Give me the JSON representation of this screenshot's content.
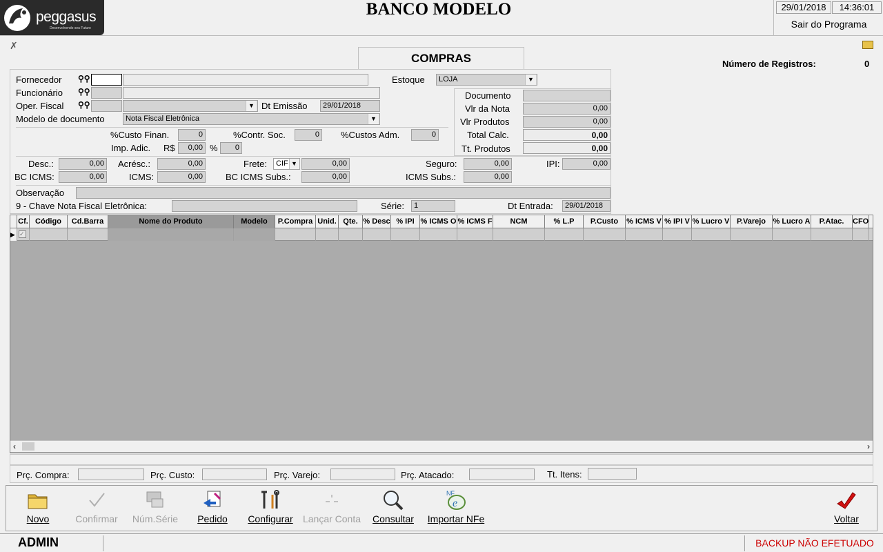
{
  "header": {
    "logo_text": "peggasus",
    "logo_tagline": "Desenvolvendo seu Futuro",
    "title": "BANCO MODELO",
    "date": "29/01/2018",
    "time": "14:36:01",
    "exit_label": "Sair do Programa"
  },
  "form": {
    "title": "COMPRAS",
    "num_registros_label": "Número de Registros:",
    "num_registros_value": "0",
    "fornecedor_label": "Fornecedor",
    "funcionario_label": "Funcionário",
    "oper_fiscal_label": "Oper. Fiscal",
    "modelo_doc_label": "Modelo de documento",
    "modelo_doc_value": "Nota Fiscal Eletrônica",
    "dt_emissao_label": "Dt Emissão",
    "dt_emissao_value": "29/01/2018",
    "estoque_label": "Estoque",
    "estoque_value": "LOJA",
    "documento_label": "Documento",
    "vlr_nota_label": "Vlr da Nota",
    "vlr_nota_value": "0,00",
    "vlr_produtos_label": "Vlr Produtos",
    "vlr_produtos_value": "0,00",
    "total_calc_label": "Total Calc.",
    "total_calc_value": "0,00",
    "tt_produtos_label": "Tt. Produtos",
    "tt_produtos_value": "0,00",
    "custo_finan_label": "%Custo Finan.",
    "custo_finan_value": "0",
    "contr_soc_label": "%Contr. Soc.",
    "contr_soc_value": "0",
    "custos_adm_label": "%Custos Adm.",
    "custos_adm_value": "0",
    "imp_adic_label": "Imp. Adic.",
    "rs_label": "R$",
    "imp_adic_rs_value": "0,00",
    "pct_label": "%",
    "imp_adic_pct_value": "0",
    "desc_label": "Desc.:",
    "desc_value": "0,00",
    "acresc_label": "Acrésc.:",
    "acresc_value": "0,00",
    "frete_label": "Frete:",
    "frete_type": "CIF",
    "frete_value": "0,00",
    "seguro_label": "Seguro:",
    "seguro_value": "0,00",
    "ipi_label": "IPI:",
    "ipi_value": "0,00",
    "bc_icms_label": "BC ICMS:",
    "bc_icms_value": "0,00",
    "icms_label": "ICMS:",
    "icms_value": "0,00",
    "bc_icms_subs_label": "BC ICMS Subs.:",
    "bc_icms_subs_value": "0,00",
    "icms_subs_label": "ICMS Subs.:",
    "icms_subs_value": "0,00",
    "observacao_label": "Observação",
    "chave_label": "9 - Chave Nota Fiscal Eletrônica:",
    "serie_label": "Série:",
    "serie_value": "1",
    "dt_entrada_label": "Dt Entrada:",
    "dt_entrada_value": "29/01/2018"
  },
  "grid": {
    "columns": [
      "Cf.",
      "Código",
      "Cd.Barra",
      "Nome do Produto",
      "Modelo",
      "P.Compra",
      "Unid.",
      "Qte.",
      "% Desc",
      "% IPI",
      "% ICMS O",
      "% ICMS F",
      "NCM",
      "% L.P",
      "P.Custo",
      "% ICMS V",
      "% IPI V",
      "% Lucro V",
      "P.Varejo",
      "% Lucro A",
      "P.Atac.",
      "CFO"
    ]
  },
  "footer_fields": {
    "prc_compra_label": "Prç. Compra:",
    "prc_custo_label": "Prç. Custo:",
    "prc_varejo_label": "Prç. Varejo:",
    "prc_atacado_label": "Prç. Atacado:",
    "tt_itens_label": "Tt. Itens:"
  },
  "toolbar": {
    "novo": "Novo",
    "confirmar": "Confirmar",
    "num_serie": "Núm.Série",
    "pedido": "Pedido",
    "configurar": "Configurar",
    "lancar_conta": "Lançar Conta",
    "consultar": "Consultar",
    "importar_nfe": "Importar NFe",
    "voltar": "Voltar"
  },
  "status": {
    "user": "ADMIN",
    "backup": "BACKUP NÃO EFETUADO"
  },
  "colors": {
    "backup_warning": "#cc0000",
    "field_gray": "#d4d4d4",
    "grid_bg": "#ababab"
  }
}
